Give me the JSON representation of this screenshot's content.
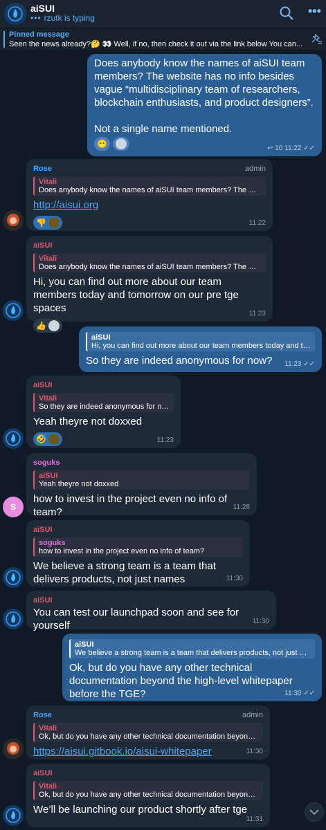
{
  "header": {
    "title": "aiSUI",
    "typing": "rzutk is typing"
  },
  "pinned": {
    "label": "Pinned message",
    "text": "Seen the news already?🤔 👀   Well, if no, then check it out via the link below  You can..."
  },
  "messages": {
    "m1": {
      "text": "Does anybody know the names of aiSUI team members? The website has no info besides vague “multidisciplinary team of researchers, blockchain enthusiasts, and product designers”.\n\nNot a single name mentioned.",
      "views": "10",
      "time": "11:22"
    },
    "m2": {
      "sender": "Rose",
      "role": "admin",
      "reply_name": "Vitali",
      "reply_text": "Does anybody know the names of aiSUI team members? The web...",
      "text": "http://aisui.org",
      "time": "11:22"
    },
    "m3": {
      "sender": "aiSUI",
      "reply_name": "Vitali",
      "reply_text": "Does anybody know the names of aiSUI team members? The web...",
      "text": "Hi, you can find out more about our team members today and tomorrow on our pre tge spaces",
      "time": "11:23"
    },
    "m4": {
      "reply_name": "aiSUI",
      "reply_text": "Hi, you can find out more about our team members today and to...",
      "text": "So they are indeed anonymous for now?",
      "time": "11:23"
    },
    "m5": {
      "sender": "aiSUI",
      "reply_name": "Vitali",
      "reply_text": "So they are indeed anonymous for now?",
      "text": "Yeah theyre not doxxed",
      "time": "11:23"
    },
    "m6": {
      "sender": "soguks",
      "reply_name": "aiSUI",
      "reply_text": "Yeah theyre not doxxed",
      "text": "how to invest in the project even no info of team?",
      "time": "11:28",
      "avatar_letter": "S"
    },
    "m7": {
      "sender": "aiSUI",
      "reply_name": "soguks",
      "reply_text": "how to invest in the project even no info of team?",
      "text": "We believe a strong team is a team that delivers products, not just names",
      "time": "11:30"
    },
    "m8": {
      "sender": "aiSUI",
      "text": "You can test our launchpad soon and see for yourself",
      "time": "11:30"
    },
    "m9": {
      "reply_name": "aiSUI",
      "reply_text": "We believe a strong team is a team that delivers products, not just na...",
      "text": "Ok, but do you have any other technical documentation beyond the high-level whitepaper before the TGE?",
      "time": "11:30"
    },
    "m10": {
      "sender": "Rose",
      "role": "admin",
      "reply_name": "Vitali",
      "reply_text": "Ok, but do you have any other technical documentation beyond t...",
      "text": "https://aisui.gitbook.io/aisui-whitepaper",
      "time": "11:30"
    },
    "m11": {
      "sender": "aiSUI",
      "reply_name": "Vitali",
      "reply_text": "Ok, but do you have any other technical documentation beyond t...",
      "text": "We’ll be launching our product shortly after tge",
      "time": "11:31"
    }
  },
  "reactions": {
    "m1": "😶",
    "m2": "👎",
    "m3": "👍",
    "m5": "🤣"
  },
  "colors": {
    "accent": "#5fa9f0",
    "incoming_bubble": "#1e2a37",
    "outgoing_bubble": "#2b5f94",
    "rose_name": "#4ea6f4",
    "aisui_name": "#e0566c",
    "soguks_name": "#e06ed6"
  }
}
